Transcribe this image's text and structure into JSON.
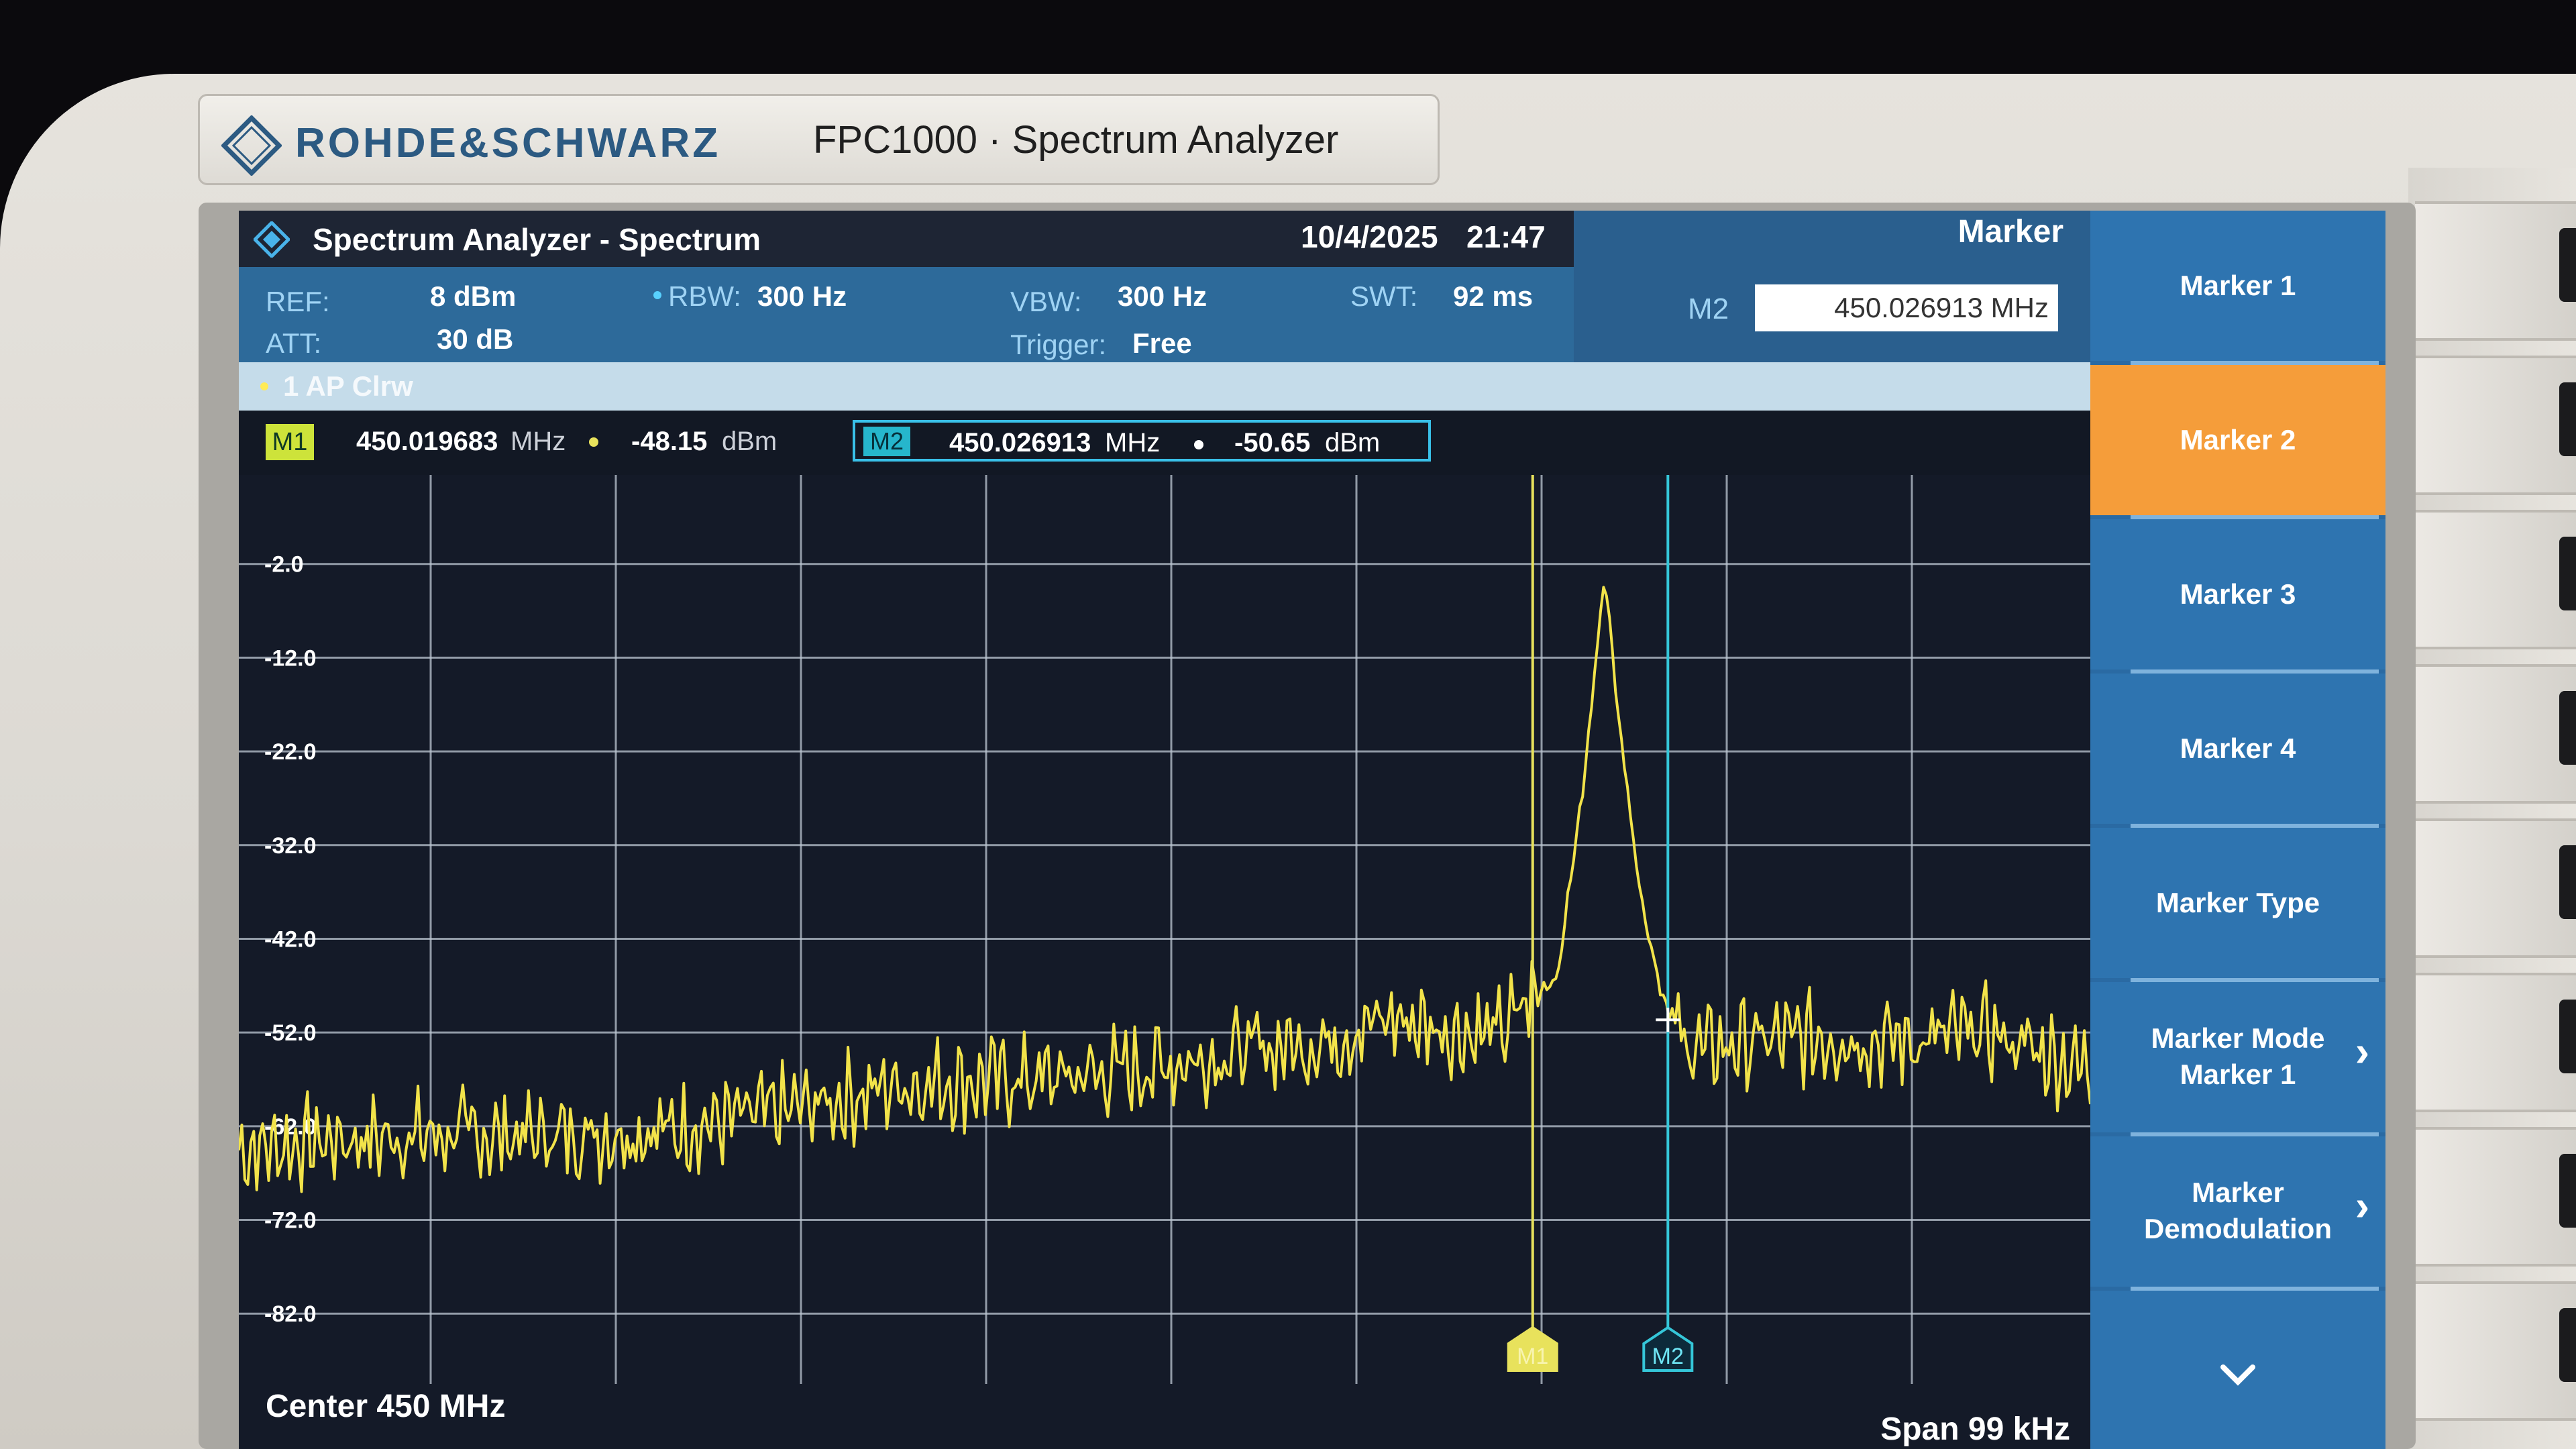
{
  "device": {
    "brand": "ROHDE&SCHWARZ",
    "model": "FPC1000 · Spectrum Analyzer"
  },
  "titlebar": {
    "title": "Spectrum Analyzer - Spectrum",
    "date": "10/4/2025",
    "time": "21:47"
  },
  "params": {
    "ref_label": "REF:",
    "ref_value": "8 dBm",
    "att_label": "ATT:",
    "att_value": "30 dB",
    "rbw_label": "RBW:",
    "rbw_value": "300 Hz",
    "vbw_label": "VBW:",
    "vbw_value": "300 Hz",
    "trigger_label": "Trigger:",
    "trigger_value": "Free",
    "swt_label": "SWT:",
    "swt_value": "92 ms"
  },
  "marker_panel": {
    "title": "Marker",
    "active_marker": "M2",
    "input_value": "450.026913 MHz"
  },
  "trace": {
    "label": "1 AP Clrw"
  },
  "markers": [
    {
      "badge": "M1",
      "freq": "450.019683",
      "freq_unit": "MHz",
      "level": "-48.15",
      "level_unit": "dBm"
    },
    {
      "badge": "M2",
      "freq": "450.026913",
      "freq_unit": "MHz",
      "level": "-50.65",
      "level_unit": "dBm"
    }
  ],
  "plot": {
    "y_ticks": [
      "-2.0",
      "-12.0",
      "-22.0",
      "-32.0",
      "-42.0",
      "-52.0",
      "-62.0",
      "-72.0",
      "-82.0"
    ],
    "center": "Center 450 MHz",
    "span": "Span 99 kHz",
    "marker_flags": [
      "M1",
      "M2"
    ],
    "colors": {
      "trace": "#f2e34a",
      "m1": "#e8e25c",
      "m2": "#35c6d8",
      "grid": "#bcc6d2"
    }
  },
  "chart_data": {
    "type": "line",
    "title": "",
    "xlabel": "",
    "ylabel": "",
    "x_center": "450 MHz",
    "x_span": "99 kHz",
    "ylim": [
      -89.5,
      7.5
    ],
    "x": [
      449.9505,
      449.9555,
      449.961,
      449.967,
      449.973,
      449.9795,
      449.986,
      449.993,
      449.9985,
      450.0,
      450.004,
      450.0085,
      450.012,
      450.016,
      450.018,
      450.0197,
      450.021,
      450.0225,
      450.0235,
      450.0245,
      450.0255,
      450.0265,
      450.027,
      450.0285,
      450.0315,
      450.0355,
      450.0395,
      450.044,
      450.0495
    ],
    "series": [
      {
        "values": [
          -64.5,
          -63.5,
          -63.0,
          -63.0,
          -62.5,
          -60.5,
          -57.5,
          -57.0,
          -56.0,
          -55.5,
          -54.0,
          -53.0,
          -50.5,
          -52.0,
          -52.0,
          -48.15,
          -46.0,
          -24.0,
          -3.0,
          -22.0,
          -38.0,
          -47.0,
          -50.65,
          -54.0,
          -53.0,
          -52.5,
          -53.0,
          -52.0,
          -56.0
        ]
      }
    ],
    "markers": [
      {
        "name": "M1",
        "x": 450.019683,
        "y": -48.15
      },
      {
        "name": "M2",
        "x": 450.026913,
        "y": -50.65
      }
    ],
    "grid": true
  },
  "softkeys": [
    {
      "label": "Marker 1",
      "active": false
    },
    {
      "label": "Marker 2",
      "active": true
    },
    {
      "label": "Marker 3",
      "active": false
    },
    {
      "label": "Marker 4",
      "active": false
    },
    {
      "label": "Marker Type",
      "active": false
    },
    {
      "label": "Marker Mode",
      "label2": "Marker 1",
      "arrow": "›",
      "active": false
    },
    {
      "label": "Marker",
      "label2": "Demodulation",
      "arrow": "›",
      "active": false
    }
  ]
}
